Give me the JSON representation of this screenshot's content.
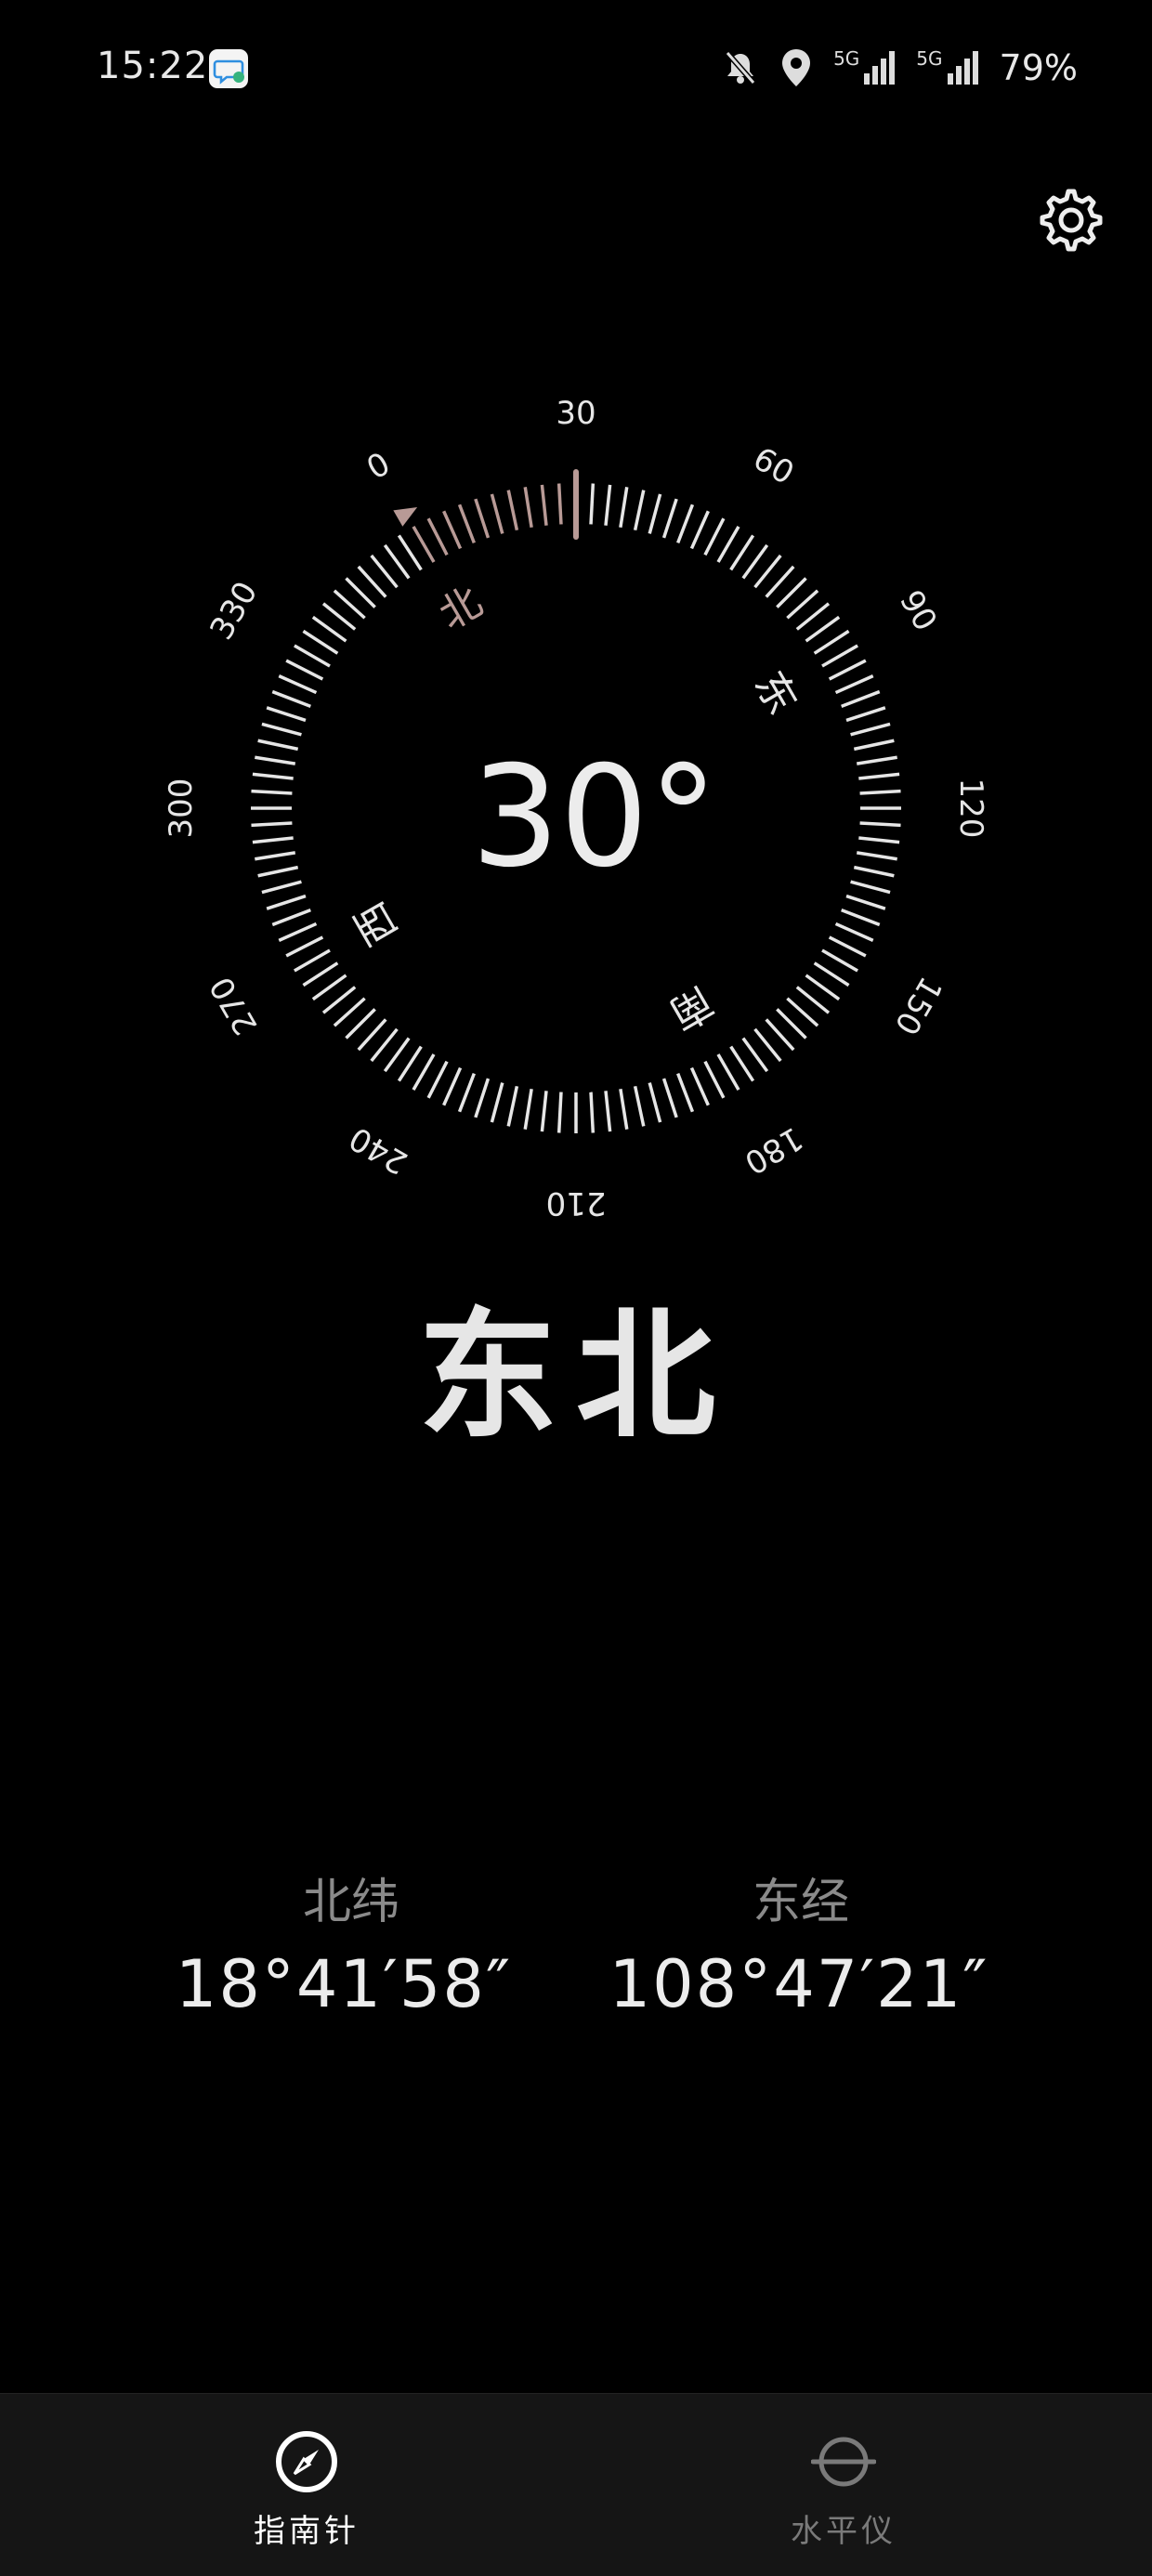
{
  "status_bar": {
    "time": "15:22",
    "network1": "5G",
    "network2": "5G",
    "battery": "79%"
  },
  "compass": {
    "heading_value": "30°",
    "pointer_degrees": 30,
    "north_arc_from_degrees": 0,
    "north_arc_to_degrees": 30,
    "degree_labels": [
      "0",
      "30",
      "60",
      "90",
      "120",
      "150",
      "180",
      "210",
      "240",
      "270",
      "300",
      "330"
    ],
    "cardinals": {
      "north": "北",
      "east": "东",
      "south": "南",
      "west": "西"
    },
    "accent_color": "#b89a96",
    "tick_color": "#e6e6e6"
  },
  "direction_name": "东北",
  "coordinates": {
    "latitude_label": "北纬",
    "latitude_value": "18°41′58″",
    "longitude_label": "东经",
    "longitude_value": "108°47′21″"
  },
  "nav": {
    "compass_label": "指南针",
    "level_label": "水平仪",
    "active_color": "#ffffff",
    "inactive_color": "#7a7a7a"
  },
  "icons": {
    "settings": "gear-icon",
    "notifications_off": "bell-off-icon",
    "location": "location-pin-icon",
    "compass_tab": "compass-icon",
    "level_tab": "level-icon",
    "message": "message-icon"
  }
}
